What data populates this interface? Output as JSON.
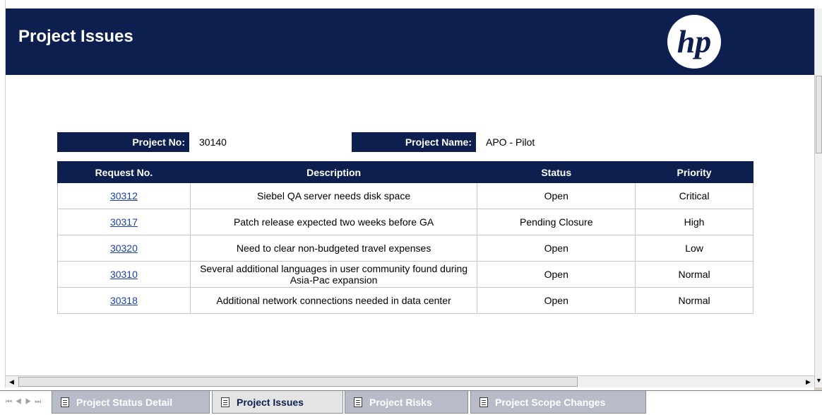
{
  "header": {
    "title": "Project Issues",
    "logo_text": "hp"
  },
  "project": {
    "number_label": "Project No:",
    "number_value": "30140",
    "name_label": "Project Name:",
    "name_value": "APO - Pilot"
  },
  "table": {
    "columns": [
      "Request No.",
      "Description",
      "Status",
      "Priority"
    ],
    "rows": [
      {
        "request": "30312",
        "description": "Siebel QA server needs disk space",
        "status": "Open",
        "priority": "Critical"
      },
      {
        "request": "30317",
        "description": "Patch release expected two weeks before GA",
        "status": "Pending Closure",
        "priority": "High"
      },
      {
        "request": "30320",
        "description": "Need to clear non-budgeted travel expenses",
        "status": "Open",
        "priority": "Low"
      },
      {
        "request": "30310",
        "description": "Several additional languages in user community found during Asia-Pac expansion",
        "status": "Open",
        "priority": "Normal"
      },
      {
        "request": "30318",
        "description": "Additional network connections needed in data center",
        "status": "Open",
        "priority": "Normal"
      }
    ]
  },
  "tabs": [
    {
      "label": "Project Status Detail",
      "active": false
    },
    {
      "label": "Project Issues",
      "active": true
    },
    {
      "label": "Project Risks",
      "active": false
    },
    {
      "label": "Project Scope Changes",
      "active": false
    }
  ],
  "colors": {
    "header_bg": "#0c1f4e",
    "link": "#1a3fb0",
    "inactive_tab": "#b8bcc8"
  },
  "icons": {
    "tab_icon": "document-icon",
    "nav": [
      "first-sheet-icon",
      "prev-sheet-icon",
      "next-sheet-icon",
      "last-sheet-icon"
    ]
  }
}
